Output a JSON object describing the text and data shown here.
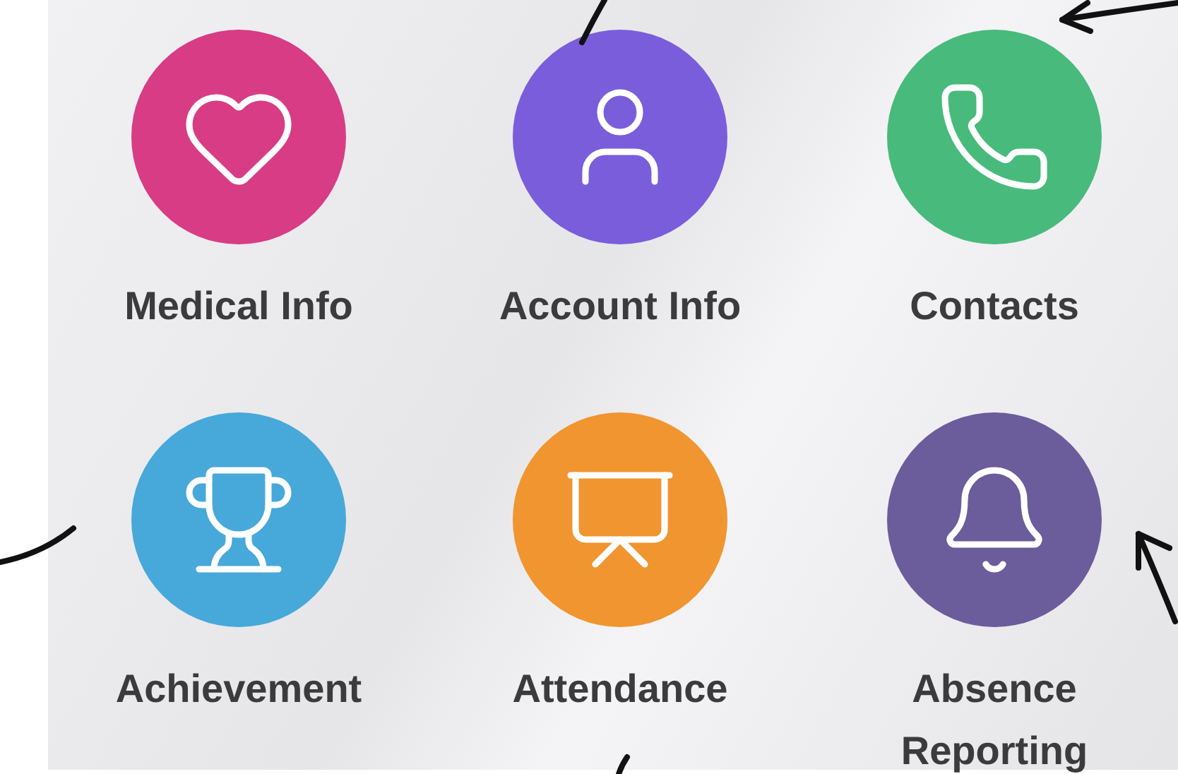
{
  "tiles": [
    {
      "label": "Medical Info",
      "kind": "heart",
      "color": "#d83c85"
    },
    {
      "label": "Account Info",
      "kind": "person",
      "color": "#7a5ddb"
    },
    {
      "label": "Contacts",
      "kind": "phone",
      "color": "#48ba7b"
    },
    {
      "label": "Achievement",
      "kind": "trophy",
      "color": "#47a8da"
    },
    {
      "label": "Attendance",
      "kind": "presentation",
      "color": "#f09530"
    },
    {
      "label": "Absence Reporting",
      "kind": "bell",
      "color": "#6b5c9c"
    }
  ]
}
